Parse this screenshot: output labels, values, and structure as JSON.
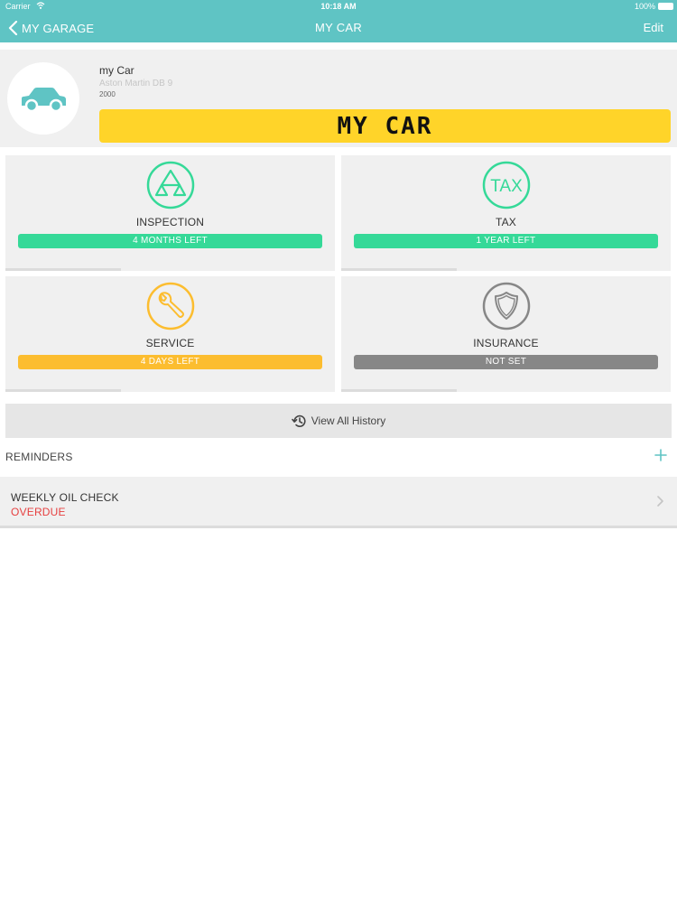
{
  "status_bar": {
    "carrier": "Carrier",
    "time": "10:18 AM",
    "battery": "100%"
  },
  "nav": {
    "back_label": "MY GARAGE",
    "title": "MY CAR",
    "edit_label": "Edit"
  },
  "car": {
    "name": "my Car",
    "model": "Aston Martin DB 9",
    "year": "2000",
    "plate": "MY CAR"
  },
  "tiles": [
    {
      "label": "INSPECTION",
      "status": "4 MONTHS LEFT",
      "color": "#35d998",
      "icon": "inspection-triangle-icon"
    },
    {
      "label": "TAX",
      "status": "1 YEAR LEFT",
      "color": "#35d998",
      "icon": "tax-icon",
      "icon_text": "TAX"
    },
    {
      "label": "SERVICE",
      "status": "4 DAYS LEFT",
      "color": "#fcbd2f",
      "icon": "wrench-icon"
    },
    {
      "label": "INSURANCE",
      "status": "NOT SET",
      "color": "#878787",
      "icon": "shield-icon"
    }
  ],
  "history": {
    "label": "View All History"
  },
  "reminders": {
    "header": "REMINDERS",
    "items": [
      {
        "title": "WEEKLY OIL CHECK",
        "status": "OVERDUE"
      }
    ]
  },
  "colors": {
    "accent": "#5fc4c4",
    "plate": "#ffd429",
    "overdue": "#e64040"
  }
}
